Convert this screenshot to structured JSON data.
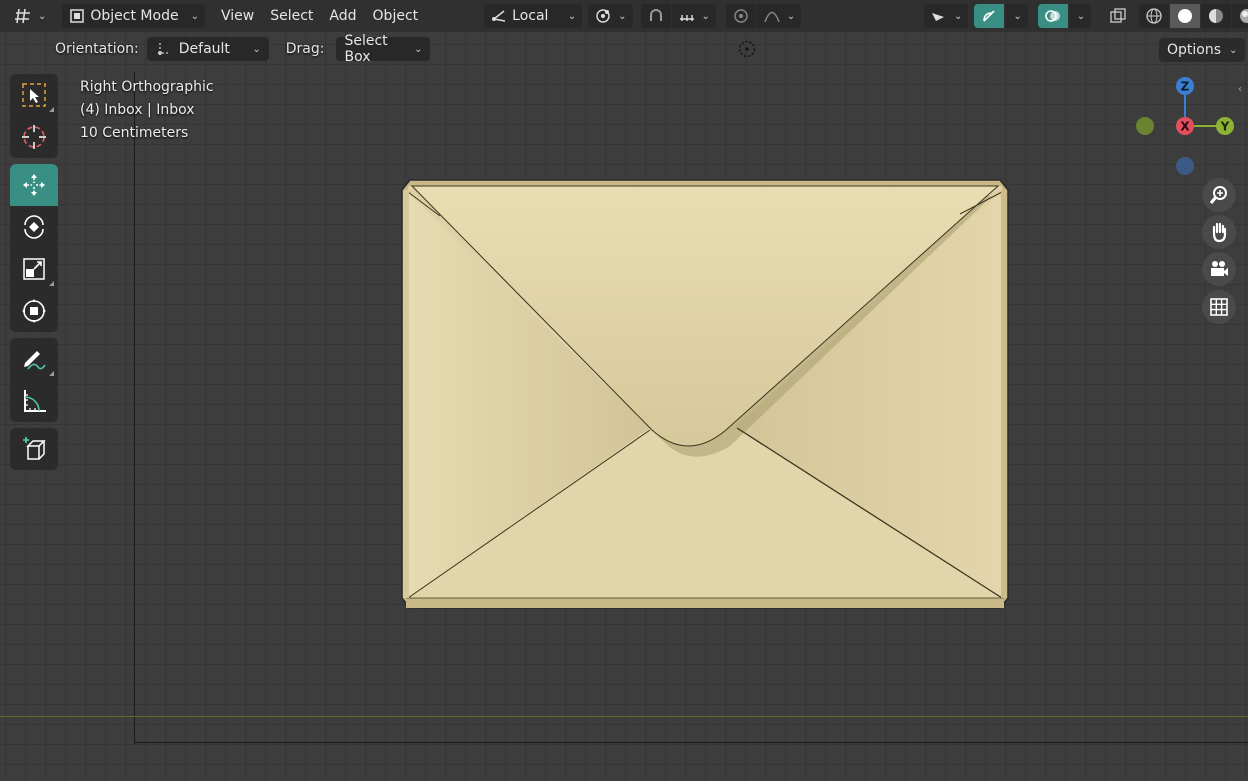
{
  "header": {
    "editor_type_icon": "editor-grid-icon",
    "mode_label": "Object Mode",
    "menus": [
      "View",
      "Select",
      "Add",
      "Object"
    ],
    "transform_orientation": "Local",
    "icons": [
      "pivot-icon",
      "snap-icon",
      "snap-increment-icon",
      "proportional-edit-icon",
      "falloff-icon",
      "visibility-icon",
      "gizmo-icon",
      "overlay-icon",
      "xray-icon",
      "wireframe-shading-icon",
      "solid-shading-icon",
      "material-shading-icon",
      "rendered-shading-icon"
    ]
  },
  "subheader": {
    "orientation_label": "Orientation:",
    "orientation_value": "Default",
    "drag_label": "Drag:",
    "drag_value": "Select Box",
    "options_label": "Options"
  },
  "overlay": {
    "view_name": "Right Orthographic",
    "collection": "(4) Inbox | Inbox",
    "scale": "10 Centimeters"
  },
  "gizmo": {
    "z_label": "Z",
    "x_label": "X",
    "y_label": "Y",
    "colors": {
      "x": "#e34f5e",
      "y": "#8cb333",
      "z": "#3b7fd4"
    }
  },
  "toolbar": {
    "tools": [
      "select-box-icon",
      "cursor-icon",
      "move-icon",
      "rotate-icon",
      "scale-icon",
      "transform-icon",
      "annotate-icon",
      "measure-icon",
      "add-cube-icon"
    ],
    "active_tool": "move-icon"
  },
  "colors": {
    "accent": "#3a8f84",
    "envelope": "#e2d3a5",
    "background": "#3d3d3d"
  }
}
